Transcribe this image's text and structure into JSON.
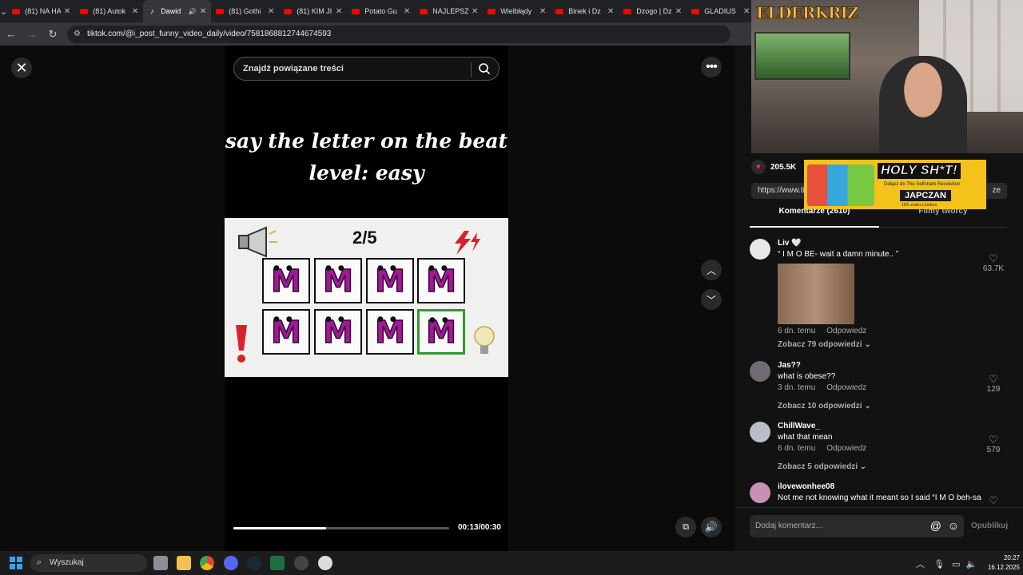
{
  "browser": {
    "tabs": [
      {
        "label": "(81) NA HA",
        "icon": "youtube-icon",
        "active": false
      },
      {
        "label": "(81) Autok",
        "icon": "youtube-icon",
        "active": false
      },
      {
        "label": "Dawid",
        "icon": "tiktok-icon",
        "active": true
      },
      {
        "label": "(81) Gothi",
        "icon": "youtube-icon",
        "active": false
      },
      {
        "label": "(81) KIM JI",
        "icon": "youtube-icon",
        "active": false
      },
      {
        "label": "Potato Gu",
        "icon": "youtube-icon",
        "active": false
      },
      {
        "label": "NAJLEPSZ",
        "icon": "youtube-icon",
        "active": false
      },
      {
        "label": "Wielbłądy",
        "icon": "youtube-icon",
        "active": false
      },
      {
        "label": "Binek i Dz",
        "icon": "youtube-icon",
        "active": false
      },
      {
        "label": "Dzogo | Dz",
        "icon": "youtube-icon",
        "active": false
      },
      {
        "label": "GLADIUS",
        "icon": "youtube-icon",
        "active": false
      }
    ],
    "url": "tiktok.com/@i_post_funny_video_daily/video/7581868812744674593"
  },
  "video": {
    "search_placeholder": "Znajdź powiązane treści",
    "caption_line1": "say the letter on the beat",
    "caption_line2": "level: easy",
    "counter": "2/5",
    "letters": [
      "M",
      "M",
      "M",
      "M",
      "M",
      "M",
      "M",
      "M"
    ],
    "highlighted_index": 7,
    "time": "00:13/00:30",
    "progress": 0.43
  },
  "panel": {
    "likes": "205.5K",
    "link_prefix": "https://www.ti",
    "link_suffix": "ze",
    "tab_comments": "Komentarze (2610)",
    "tab_creator": "Filmy twórcy",
    "comments": [
      {
        "name": "Liv 🤍",
        "text": "“ I M O BE- wait a damn minute.. ”",
        "meta": "6 dn. temu",
        "reply": "Odpowiedz",
        "more": "Zobacz 79 odpowiedzi ⌄",
        "likes": "63.7K"
      },
      {
        "name": "Jas??",
        "text": "what is obese??",
        "meta": "3 dn. temu",
        "reply": "Odpowiedz",
        "more": "Zobacz 10 odpowiedzi ⌄",
        "likes": "129"
      },
      {
        "name": "ChillWave_",
        "text": "what that mean",
        "meta": "6 dn. temu",
        "reply": "Odpowiedz",
        "more": "Zobacz 5 odpowiedzi ⌄",
        "likes": "579"
      },
      {
        "name": "ilovewonhee08",
        "text": "Not me not knowing what it meant so I said “I M O beh-sa"
      }
    ],
    "comment_placeholder": "Dodaj komentarz...",
    "post_label": "Opublikuj"
  },
  "stream_overlay": {
    "logo": "ELDERKRIZ",
    "ad_title": "HOLY SH*T!",
    "ad_sub": "Dołącz do The Selfshark Revolution",
    "ad_brand": "JAPCZAN",
    "ad_promo": "10% zniżki z kodem"
  },
  "taskbar": {
    "search_label": "Wyszukaj",
    "time": "20:27",
    "date": "16.12.2025"
  }
}
